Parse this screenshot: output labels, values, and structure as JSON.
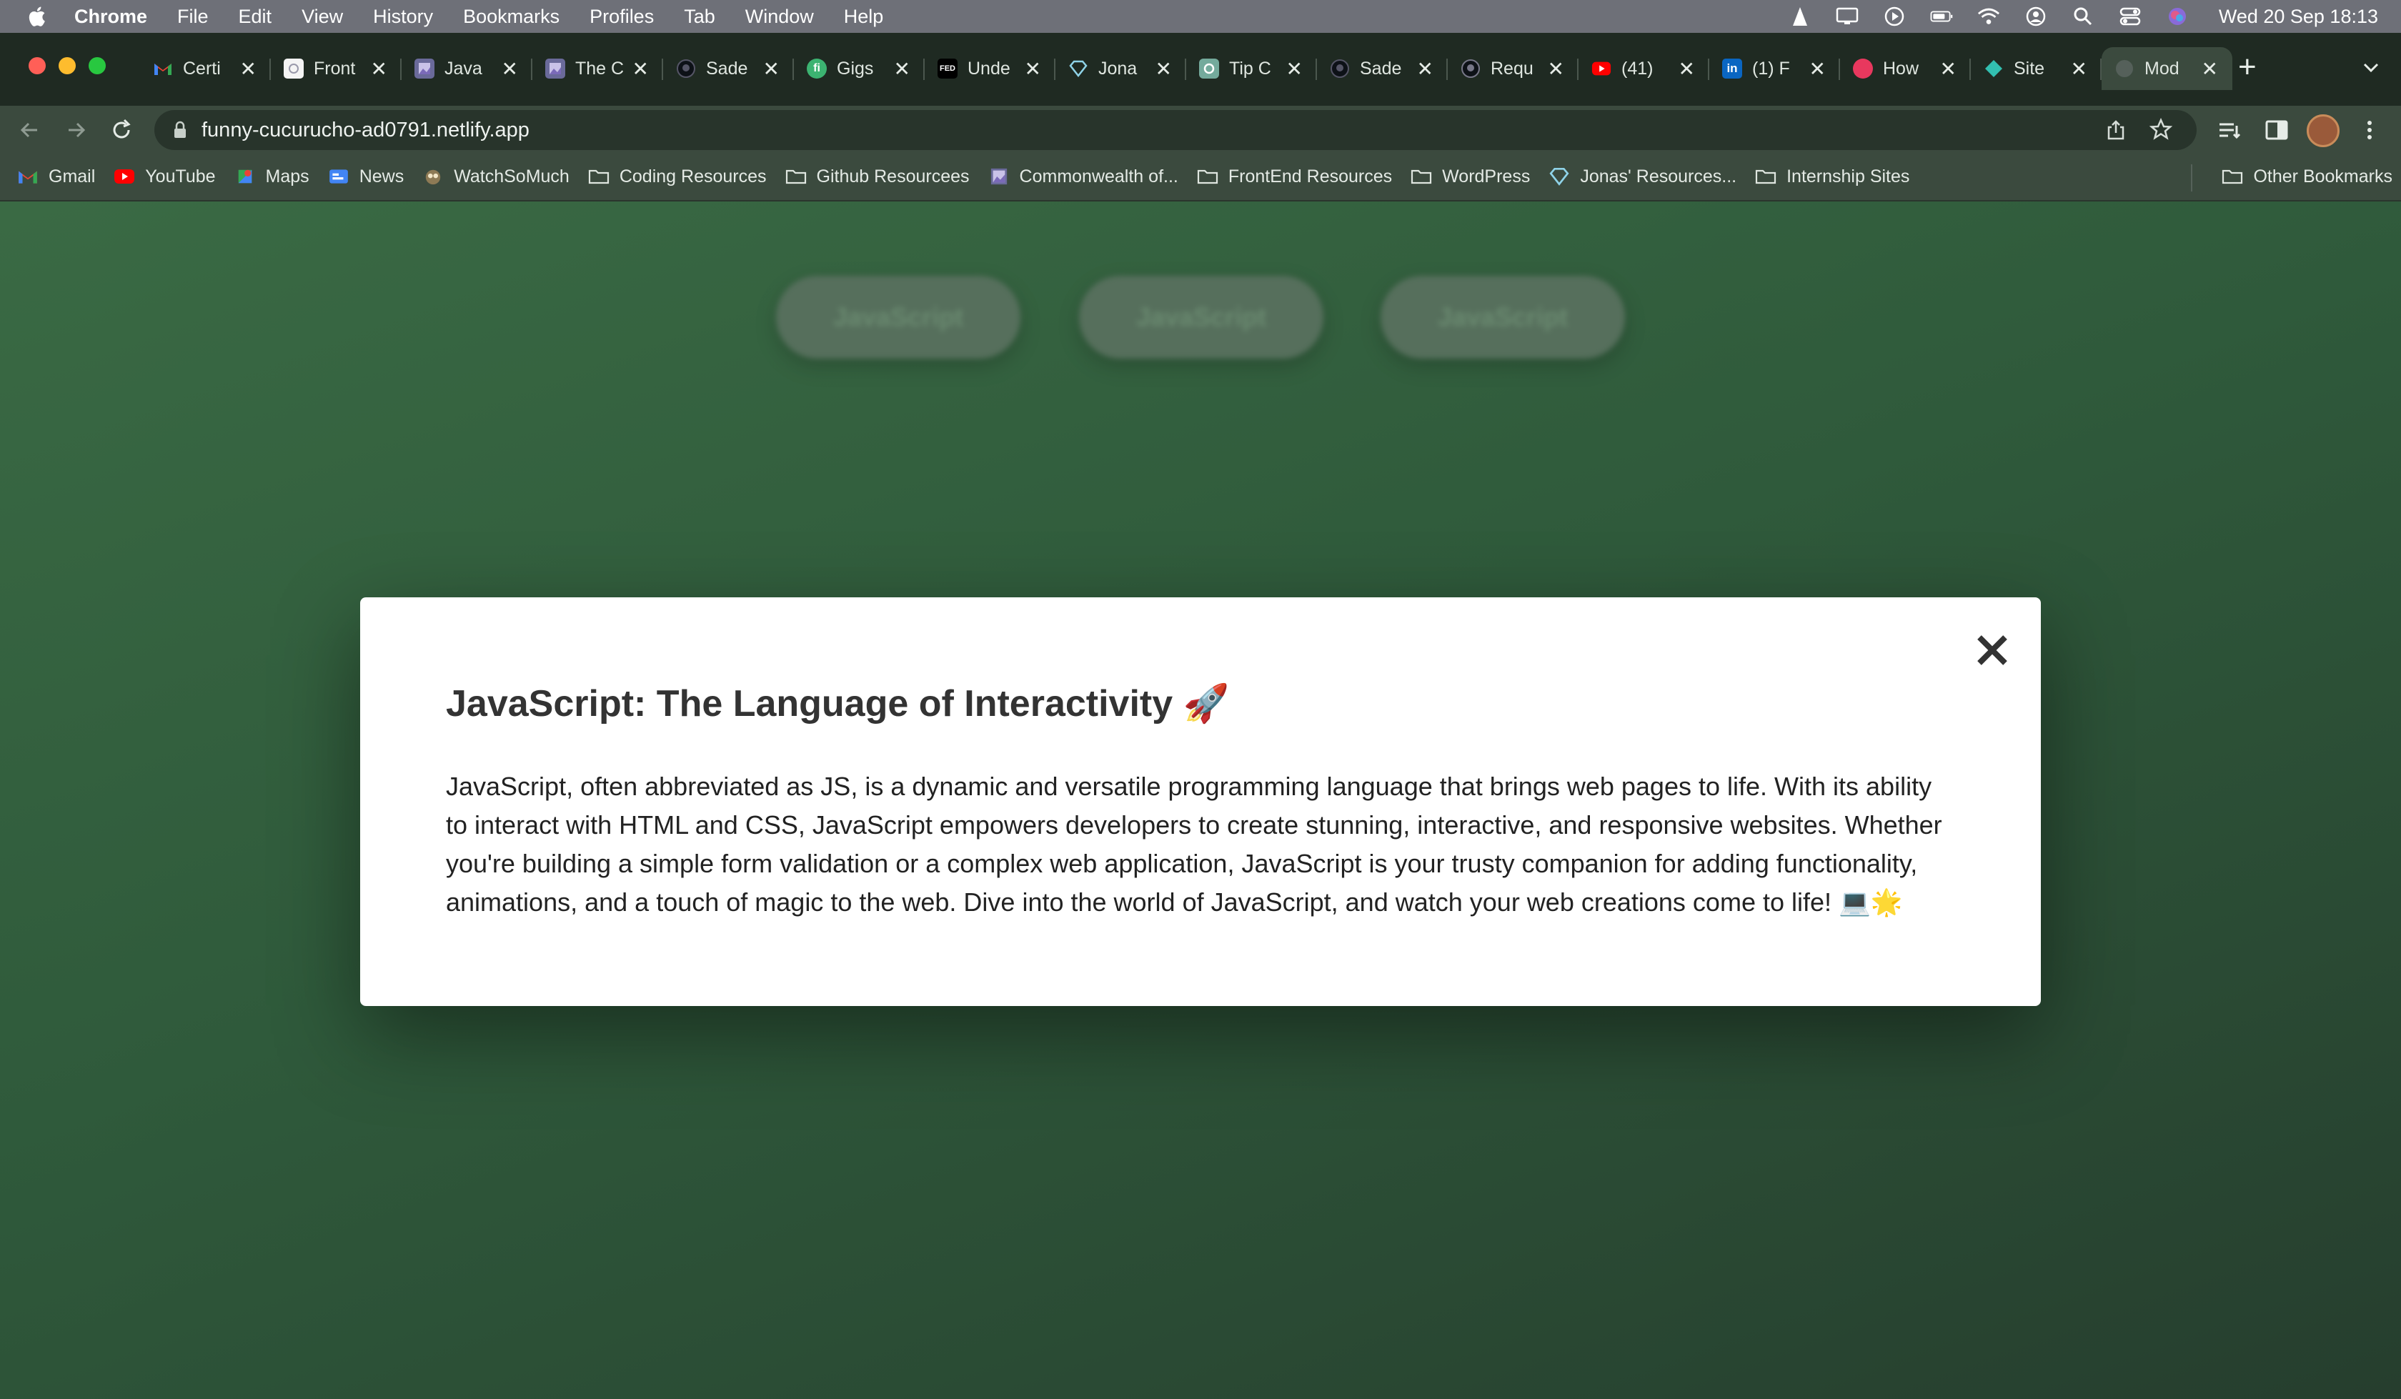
{
  "menubar": {
    "app_name": "Chrome",
    "items": [
      "File",
      "Edit",
      "View",
      "History",
      "Bookmarks",
      "Profiles",
      "Tab",
      "Window",
      "Help"
    ],
    "clock": "Wed 20 Sep  18:13"
  },
  "tabs": [
    {
      "title": "Certi",
      "icon": "gmail-icon"
    },
    {
      "title": "Front",
      "icon": "page-icon"
    },
    {
      "title": "Java",
      "icon": "image-icon"
    },
    {
      "title": "The C",
      "icon": "image-icon"
    },
    {
      "title": "Sade",
      "icon": "github-icon"
    },
    {
      "title": "Gigs",
      "icon": "fiverr-icon",
      "badge": "fi"
    },
    {
      "title": "Unde",
      "icon": "fed-icon",
      "badge": "FED"
    },
    {
      "title": "Jona",
      "icon": "diamond-icon"
    },
    {
      "title": "Tip C",
      "icon": "openai-icon"
    },
    {
      "title": "Sade",
      "icon": "github-icon"
    },
    {
      "title": "Requ",
      "icon": "github-icon"
    },
    {
      "title": "(41)",
      "icon": "youtube-icon"
    },
    {
      "title": "(1) F",
      "icon": "linkedin-icon",
      "badge": "in"
    },
    {
      "title": "How",
      "icon": "hashnode-icon"
    },
    {
      "title": "Site",
      "icon": "netlify-icon"
    },
    {
      "title": "Mod",
      "icon": "globe-icon",
      "active": true
    }
  ],
  "toolbar": {
    "url": "funny-cucurucho-ad0791.netlify.app"
  },
  "bookmarks": [
    {
      "label": "Gmail",
      "icon": "gmail-icon"
    },
    {
      "label": "YouTube",
      "icon": "youtube-icon"
    },
    {
      "label": "Maps",
      "icon": "maps-icon"
    },
    {
      "label": "News",
      "icon": "news-icon"
    },
    {
      "label": "WatchSoMuch",
      "icon": "owl-icon"
    },
    {
      "label": "Coding Resources",
      "icon": "folder-icon"
    },
    {
      "label": "Github Resourcees",
      "icon": "folder-icon"
    },
    {
      "label": "Commonwealth of...",
      "icon": "image-icon"
    },
    {
      "label": "FrontEnd Resources",
      "icon": "folder-icon"
    },
    {
      "label": "WordPress",
      "icon": "folder-icon"
    },
    {
      "label": "Jonas' Resources...",
      "icon": "diamond-icon"
    },
    {
      "label": "Internship Sites",
      "icon": "folder-icon"
    }
  ],
  "other_bookmarks": "Other Bookmarks",
  "page": {
    "buttons": [
      "JavaScript",
      "JavaScript",
      "JavaScript"
    ],
    "modal": {
      "title": "JavaScript: The Language of Interactivity 🚀",
      "body": "JavaScript, often abbreviated as JS, is a dynamic and versatile programming language that brings web pages to life. With its ability to interact with HTML and CSS, JavaScript empowers developers to create stunning, interactive, and responsive websites. Whether you're building a simple form validation or a complex web application, JavaScript is your trusty companion for adding functionality, animations, and a touch of magic to the web. Dive into the world of JavaScript, and watch your web creations come to life! 💻🌟"
    }
  },
  "colors": {
    "page_background": "#2f5a3b",
    "modal_background": "#ffffff",
    "youtube_red": "#ff0000",
    "linkedin_blue": "#0a66c2"
  }
}
